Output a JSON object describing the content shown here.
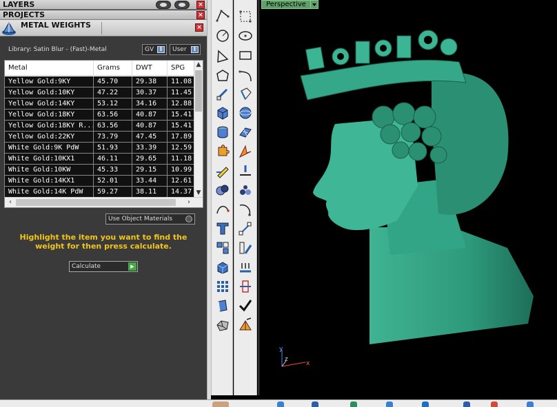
{
  "panels": {
    "layers_title": "LAYERS",
    "projects_title": "PROJECTS",
    "metal_weights_title": "METAL WEIGHTS"
  },
  "library": {
    "label": "Library: Satin Blur - (Fast)-Metal",
    "gv_button": "GV",
    "user_button": "User"
  },
  "table": {
    "headers": [
      "Metal",
      "Grams",
      "DWT",
      "SPG"
    ],
    "rows": [
      [
        "Yellow Gold:9KY",
        "45.70",
        "29.38",
        "11.08"
      ],
      [
        "Yellow Gold:10KY",
        "47.22",
        "30.37",
        "11.45"
      ],
      [
        "Yellow Gold:14KY",
        "53.12",
        "34.16",
        "12.88"
      ],
      [
        "Yellow Gold:18KY",
        "63.56",
        "40.87",
        "15.41"
      ],
      [
        "Yellow Gold:18KY R...",
        "63.56",
        "40.87",
        "15.41"
      ],
      [
        "Yellow Gold:22KY",
        "73.79",
        "47.45",
        "17.89"
      ],
      [
        "White Gold:9K PdW",
        "51.93",
        "33.39",
        "12.59"
      ],
      [
        "White Gold:10KX1",
        "46.11",
        "29.65",
        "11.18"
      ],
      [
        "White Gold:10KW",
        "45.33",
        "29.15",
        "10.99"
      ],
      [
        "White Gold:14KX1",
        "52.01",
        "33.44",
        "12.61"
      ],
      [
        "White Gold:14K PdW",
        "59.27",
        "38.11",
        "14.37"
      ]
    ]
  },
  "use_object_materials": "Use Object Materials",
  "hint": "Highlight the item you want to find the weight for then press calculate.",
  "calculate_button": "Calculate",
  "viewport": {
    "label": "Perspective",
    "axes": {
      "y": "y",
      "z": "z",
      "x": "x"
    },
    "model_color": "#3aa58a"
  },
  "colors": {
    "panel_bg": "#3a3a3a",
    "hint_text": "#f3c41a",
    "viewport_label_bg": "#5f9f6b",
    "close_button": "#cc3333"
  }
}
